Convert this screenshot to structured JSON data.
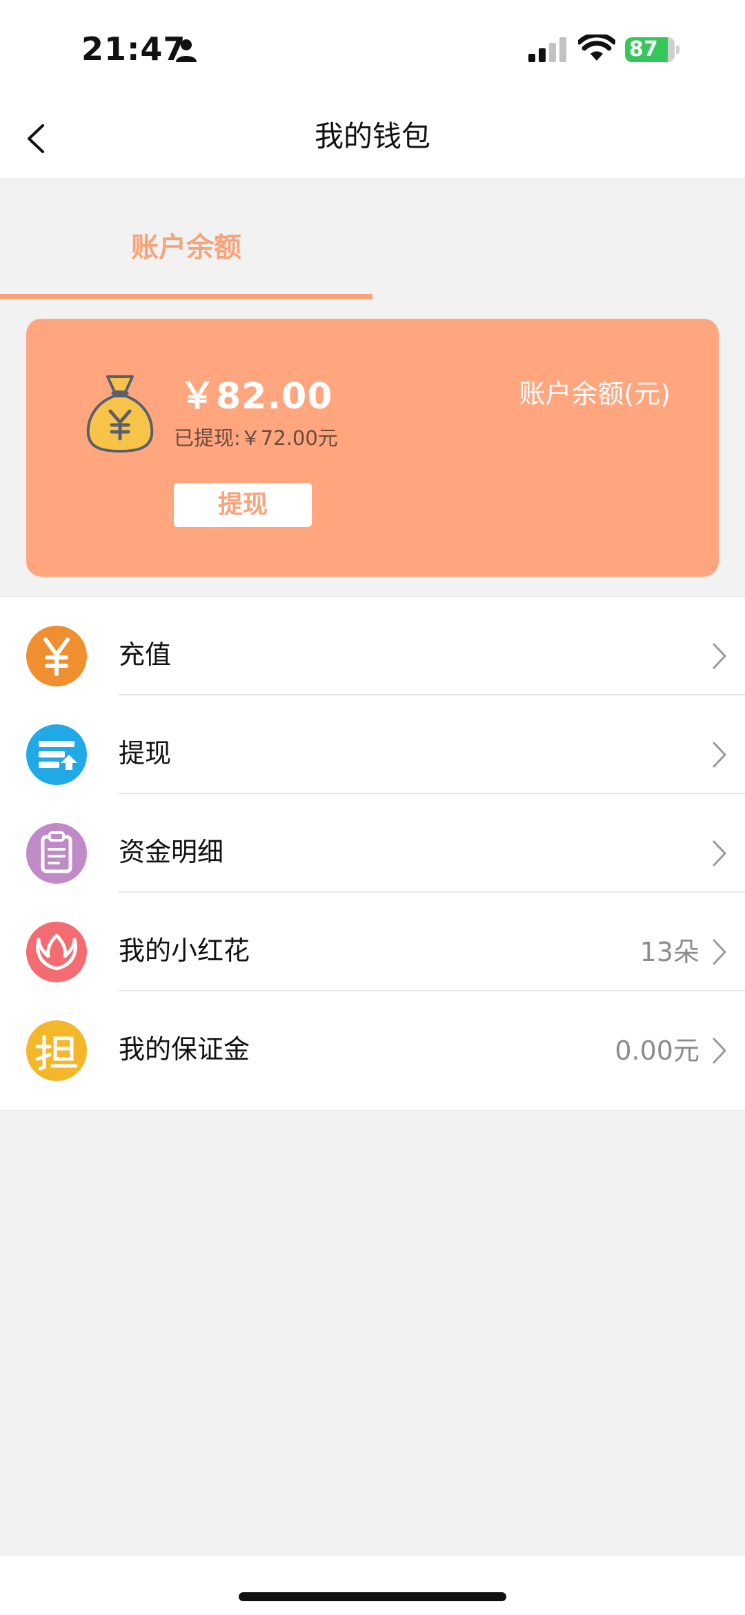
{
  "status_bar": {
    "time": "21:47",
    "battery": "87",
    "icons": [
      "person-icon",
      "signal-icon",
      "wifi-icon",
      "battery-icon"
    ]
  },
  "nav": {
    "title": "我的钱包",
    "back_icon": "chevron-left-icon"
  },
  "tab": {
    "label": "账户余额",
    "accent": "#f7a47a"
  },
  "card": {
    "balance": "￥82.00",
    "withdrawn": "已提现:￥72.00元",
    "label": "账户余额(元)",
    "button": "提现",
    "color": "#ffa67f",
    "icon": "money-bag-icon"
  },
  "menu": [
    {
      "label": "充值",
      "value": "",
      "icon": "yuan-icon",
      "color": "#ef8f2f"
    },
    {
      "label": "提现",
      "value": "",
      "icon": "withdraw-icon",
      "color": "#1fa9e6"
    },
    {
      "label": "资金明细",
      "value": "",
      "icon": "clipboard-icon",
      "color": "#bf8ac7"
    },
    {
      "label": "我的小红花",
      "value": "13朵",
      "icon": "flower-icon",
      "color": "#f56b72"
    },
    {
      "label": "我的保证金",
      "value": "0.00元",
      "icon": "guarantee-icon",
      "color": "#f5b72a"
    }
  ]
}
